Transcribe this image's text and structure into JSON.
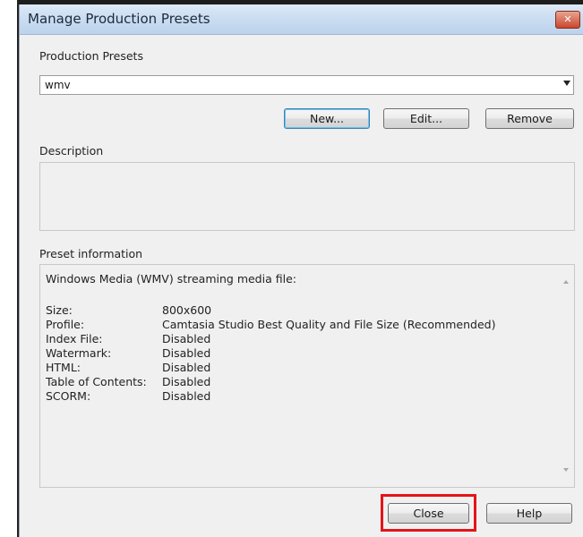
{
  "window": {
    "title": "Manage Production Presets",
    "close_glyph": "✕"
  },
  "presets": {
    "label": "Production Presets",
    "selected": "wmv"
  },
  "buttons": {
    "new": "New...",
    "edit": "Edit...",
    "remove": "Remove",
    "close": "Close",
    "help": "Help"
  },
  "description": {
    "label": "Description",
    "text": ""
  },
  "preset_info": {
    "label": "Preset information",
    "heading": "Windows Media (WMV) streaming media file:",
    "rows": [
      {
        "key": "Size:",
        "value": "800x600"
      },
      {
        "key": "Profile:",
        "value": "Camtasia Studio Best Quality and File Size (Recommended)"
      },
      {
        "key": "Index File:",
        "value": "Disabled"
      },
      {
        "key": "Watermark:",
        "value": "Disabled"
      },
      {
        "key": "HTML:",
        "value": "Disabled"
      },
      {
        "key": "Table of Contents:",
        "value": "Disabled"
      },
      {
        "key": "SCORM:",
        "value": "Disabled"
      }
    ]
  },
  "colors": {
    "highlight": "#e3141b",
    "titlebar": "#c9dcf1",
    "dialog_bg": "#f0f0f0"
  }
}
